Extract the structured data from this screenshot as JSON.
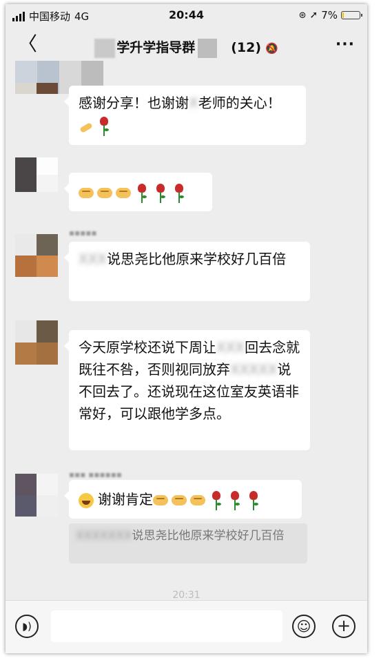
{
  "status": {
    "carrier": "中国移动",
    "network": "4G",
    "time": "20:44",
    "battery": "7%"
  },
  "nav": {
    "back": "〈",
    "title": "学升学指导群",
    "member_count": "(12)",
    "more": "···"
  },
  "messages": [
    {
      "text_before": "感谢分享！也谢谢",
      "text_after": "老师的关心！"
    },
    {
      "text": ""
    },
    {
      "text": "说思尧比他原来学校好几百倍"
    },
    {
      "part1": "今天原学校还说下周让",
      "part2": "回去念就既往不咎，否则视同放弃",
      "part3": "说不回去了。还说现在这位室友英语非常好，可以跟他学多点。"
    },
    {
      "text": "谢谢肯定"
    }
  ],
  "quote": {
    "text": "说思尧比他原来学校好几百倍"
  },
  "timestamp": "20:31",
  "input": {
    "placeholder": ""
  }
}
